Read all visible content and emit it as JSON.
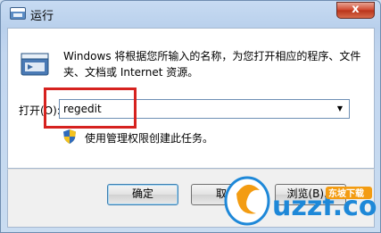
{
  "window": {
    "title": "运行",
    "close_glyph": "x"
  },
  "dialog": {
    "description": "Windows 将根据您所输入的名称，为您打开相应的程序、文件夹、文档或 Internet 资源。",
    "open_label": "打开(O):",
    "open_value": "regedit",
    "admin_note": "使用管理权限创建此任务。"
  },
  "buttons": {
    "ok": "确定",
    "cancel": "取消",
    "browse": "浏览(B)..."
  },
  "watermark": {
    "brand": "uzzf.com",
    "tagline": "东坡下载"
  },
  "colors": {
    "highlight": "#d6221f",
    "watermark_blue": "#1e88d8",
    "watermark_orange": "#f39c12"
  },
  "icons": {
    "app": "run-icon",
    "shield": "uac-shield-icon",
    "dropdown": "chevron-down-icon"
  }
}
